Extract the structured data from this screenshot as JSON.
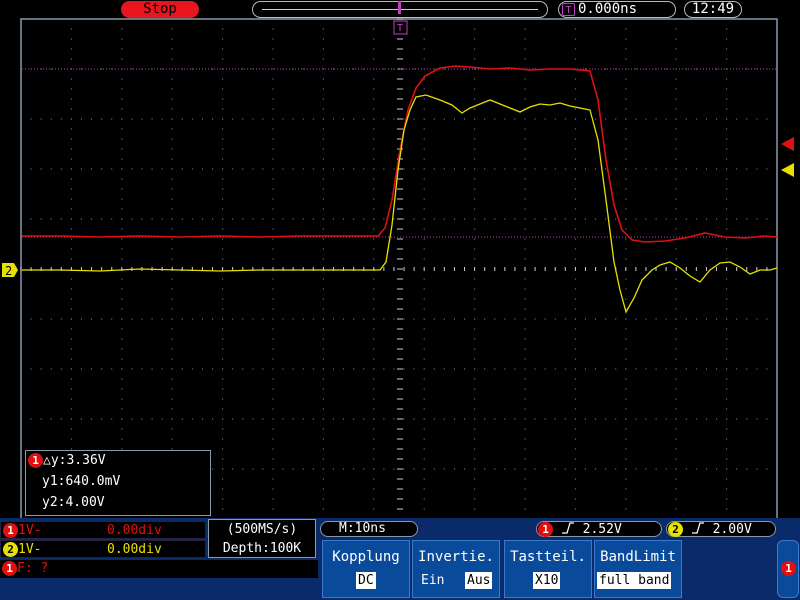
{
  "header": {
    "run_state": "Stop",
    "trigger_position": "0.000ns",
    "clock": "12:49",
    "t_badge": "T"
  },
  "channel_markers": {
    "ch2_label": "2"
  },
  "cursor_info": {
    "ch_badge": "1",
    "delta_y": "△y:3.36V",
    "y1": "y1:640.0mV",
    "y2": "y2:4.00V"
  },
  "channels": {
    "ch1": {
      "badge": "1",
      "label": "1V-",
      "offset": "0.00div"
    },
    "ch2": {
      "badge": "2",
      "label": "1V-",
      "offset": "0.00div"
    }
  },
  "frequency": {
    "badge": "1",
    "text": "F:  ?"
  },
  "acquisition": {
    "sample_rate": "(500MS/s)",
    "depth": "Depth:100K"
  },
  "timebase": {
    "main": "M:10ns"
  },
  "triggers": [
    {
      "badge": "1",
      "level": "2.52V",
      "color": "#e01010"
    },
    {
      "badge": "2",
      "level": "2.00V",
      "color": "#e8e000"
    }
  ],
  "menu": {
    "coupling": {
      "title": "Kopplung",
      "value": "DC"
    },
    "invert": {
      "title": "Invertie.",
      "option_on": "Ein",
      "option_off": "Aus"
    },
    "probe": {
      "title": "Tastteil.",
      "value": "X10"
    },
    "bandlimit": {
      "title": "BandLimit",
      "value": "full band"
    },
    "side_badge": "1"
  },
  "colors": {
    "ch1": "#e01010",
    "ch2": "#e8e000",
    "cursor": "#c040c0",
    "grid": "#8899aa"
  },
  "icons": [
    "trigger-position-icon",
    "rising-edge-icon",
    "ch1-trigger-arrow-icon",
    "ch2-trigger-arrow-icon"
  ]
}
